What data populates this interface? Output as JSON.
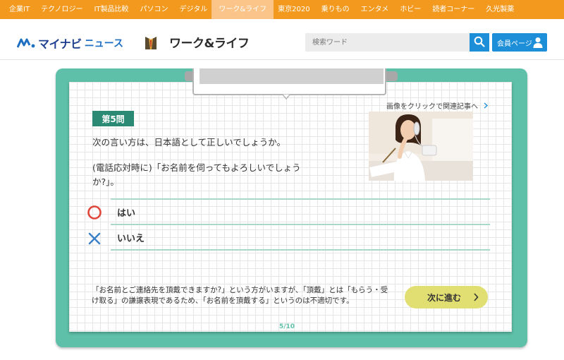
{
  "nav": {
    "items": [
      "企業IT",
      "テクノロジー",
      "IT製品比較",
      "パソコン",
      "デジタル",
      "ワーク&ライフ",
      "東京2020",
      "乗りもの",
      "エンタメ",
      "ホビー",
      "読者コーナー",
      "久光製薬"
    ],
    "active_index": 5
  },
  "header": {
    "logo_text": "マイナビ",
    "logo_news": "ニュース",
    "section_title": "ワーク&ライフ",
    "search_placeholder": "検索ワード",
    "member_label": "会員ページ"
  },
  "quiz": {
    "badge": "第5問",
    "question_line1": "次の言い方は、日本語として正しいでしょうか。",
    "question_line2": "(電話応対時に)「お名前を伺ってもよろしいでしょうか?」。",
    "photo_link": "画像をクリックで関連記事へ",
    "choices": [
      {
        "label": "はい",
        "icon": "circle-icon"
      },
      {
        "label": "いいえ",
        "icon": "cross-icon"
      }
    ],
    "explanation": "「お名前とご連絡先を頂戴できますか?」という方がいますが、「頂戴」とは「もらう・受け取る」の謙譲表現であるため、「お名前を頂戴する」というのは不適切です。",
    "next_label": "次に進む",
    "page": "5/10"
  },
  "colors": {
    "nav_bg": "#f39a1e",
    "nav_active": "#fbc58a",
    "frame": "#5ec0a8",
    "badge": "#2a8a73",
    "accent_blue": "#1d8fd9",
    "next_btn": "#e1df72",
    "circle": "#e0463a",
    "cross": "#3a7fc7"
  }
}
